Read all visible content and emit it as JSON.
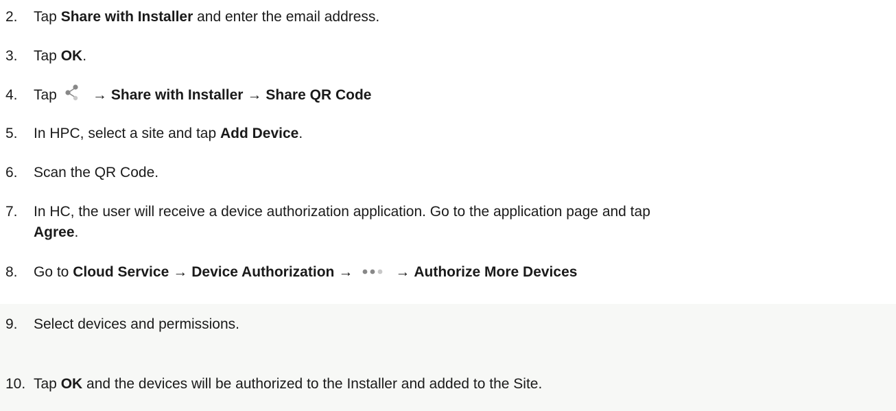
{
  "steps": [
    {
      "num": "2.",
      "parts": [
        "Tap ",
        "Share with Installer",
        " and enter the email address."
      ]
    },
    {
      "num": "3.",
      "parts": [
        "Tap ",
        "OK",
        "."
      ]
    },
    {
      "num": "4.",
      "parts": [
        "Tap",
        "→",
        "Share with Installer",
        "→",
        "Share QR Code"
      ]
    },
    {
      "num": "5.",
      "parts": [
        "In HPC, select a site and tap ",
        "Add Device",
        "."
      ]
    },
    {
      "num": "6.",
      "parts": [
        "Scan the QR Code."
      ]
    },
    {
      "num": "7.",
      "parts": [
        "In HC, the user will receive a device authorization application. Go to the application page and tap",
        "Agree",
        "."
      ]
    },
    {
      "num": "8.",
      "parts": [
        "Go to ",
        "Cloud Service",
        "→",
        "Device Authorization",
        "→",
        "→",
        "Authorize More Devices"
      ]
    },
    {
      "num": "9.",
      "parts": [
        "Select devices and permissions."
      ]
    },
    {
      "num": "10.",
      "parts": [
        "Tap ",
        "OK",
        " and the devices will be authorized to the Installer and added to the Site."
      ]
    }
  ],
  "icons": {
    "share": "share-icon",
    "more": "more-dots-icon"
  },
  "colors": {
    "text": "#1a1a1a",
    "icon": "#888888",
    "band": "#f7f8f6"
  }
}
